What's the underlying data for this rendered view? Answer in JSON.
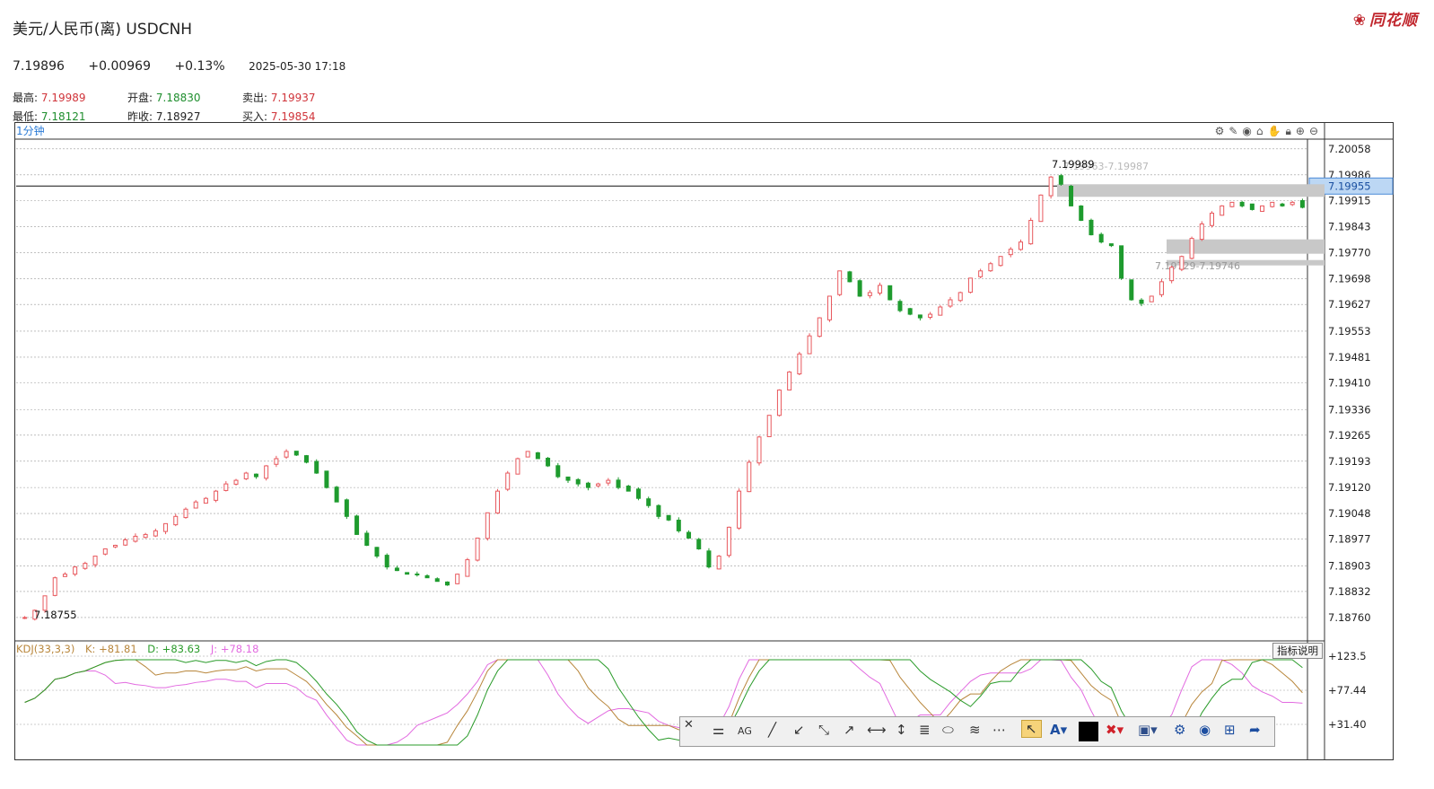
{
  "header": {
    "title": "美元/人民币(离) USDCNH",
    "logo_text": "同花顺",
    "price": "7.19896",
    "change": "+0.00969",
    "change_pct": "+0.13%",
    "timestamp": "2025-05-30 17:18"
  },
  "stats": [
    {
      "label": "最高:",
      "value": "7.19989",
      "color": "red"
    },
    {
      "label": "开盘:",
      "value": "7.18830",
      "color": "green"
    },
    {
      "label": "卖出:",
      "value": "7.19937",
      "color": "red"
    },
    {
      "label": "最低:",
      "value": "7.18121",
      "color": "green"
    },
    {
      "label": "昨收:",
      "value": "7.18927",
      "color": "black"
    },
    {
      "label": "买入:",
      "value": "7.19854",
      "color": "red"
    }
  ],
  "chart_toolbar": {
    "period": "1分钟",
    "icons": [
      "settings-icon",
      "pen-icon",
      "eye-icon",
      "lock-icon",
      "hand-icon",
      "padlock-icon",
      "zoom-in-icon",
      "zoom-out-icon"
    ]
  },
  "indicator": {
    "name": "KDJ(33,3,3)",
    "k": "K: +81.81",
    "d": "D: +83.63",
    "j": "J: +78.18",
    "help": "指标说明",
    "axis": [
      "+123.5",
      "+77.44",
      "+31.40"
    ]
  },
  "colors": {
    "up": "#e8585d",
    "down": "#1e9b2e",
    "k": "#b8863b",
    "d": "#2a9b2a",
    "j": "#e26ae0",
    "accent": "#2b7bd6"
  },
  "chart_data": {
    "type": "candlestick",
    "y_ticks": [
      "7.20058",
      "7.19986",
      "7.19915",
      "7.19843",
      "7.19770",
      "7.19698",
      "7.19627",
      "7.19553",
      "7.19481",
      "7.19410",
      "7.19336",
      "7.19265",
      "7.19193",
      "7.19120",
      "7.19048",
      "7.18977",
      "7.18903",
      "7.18832",
      "7.18760"
    ],
    "ylim": [
      7.1873,
      7.2008
    ],
    "current_price_label": "7.19955",
    "annotations": {
      "high": "7.19989",
      "low": "7.18755",
      "zone_1": "7.19963-7.19987",
      "zone_2": "7.19729-7.19746"
    },
    "close_series": [
      7.1876,
      7.1878,
      7.1882,
      7.1887,
      7.1888,
      7.189,
      7.1891,
      7.1893,
      7.1895,
      7.1896,
      7.18975,
      7.18985,
      7.1899,
      7.19,
      7.1902,
      7.1904,
      7.1906,
      7.1908,
      7.1909,
      7.1911,
      7.1913,
      7.1914,
      7.1916,
      7.1915,
      7.1918,
      7.192,
      7.1922,
      7.1921,
      7.1919,
      7.1916,
      7.1912,
      7.1908,
      7.1904,
      7.1899,
      7.1896,
      7.1893,
      7.189,
      7.1889,
      7.1888,
      7.1888,
      7.1887,
      7.1886,
      7.1885,
      7.1888,
      7.1892,
      7.1898,
      7.1905,
      7.1911,
      7.1916,
      7.192,
      7.1922,
      7.192,
      7.1918,
      7.1915,
      7.1914,
      7.1913,
      7.1912,
      7.1913,
      7.1914,
      7.1912,
      7.1911,
      7.1909,
      7.1907,
      7.1904,
      7.1903,
      7.19,
      7.1898,
      7.1895,
      7.189,
      7.1893,
      7.1901,
      7.1911,
      7.1919,
      7.1926,
      7.1932,
      7.1939,
      7.1944,
      7.1949,
      7.1954,
      7.1959,
      7.1965,
      7.1972,
      7.1969,
      7.1965,
      7.1966,
      7.1968,
      7.1964,
      7.1961,
      7.196,
      7.1959,
      7.196,
      7.1962,
      7.1964,
      7.1966,
      7.197,
      7.1972,
      7.1974,
      7.1976,
      7.1978,
      7.198,
      7.1986,
      7.1993,
      7.1998,
      7.1996,
      7.199,
      7.1986,
      7.1982,
      7.198,
      7.1979,
      7.197,
      7.1964,
      7.1963,
      7.1965,
      7.1969,
      7.1973,
      7.1976,
      7.1981,
      7.1985,
      7.1988,
      7.199,
      7.1991,
      7.199,
      7.1989,
      7.199,
      7.1991,
      7.199,
      7.1991,
      7.19896
    ]
  }
}
